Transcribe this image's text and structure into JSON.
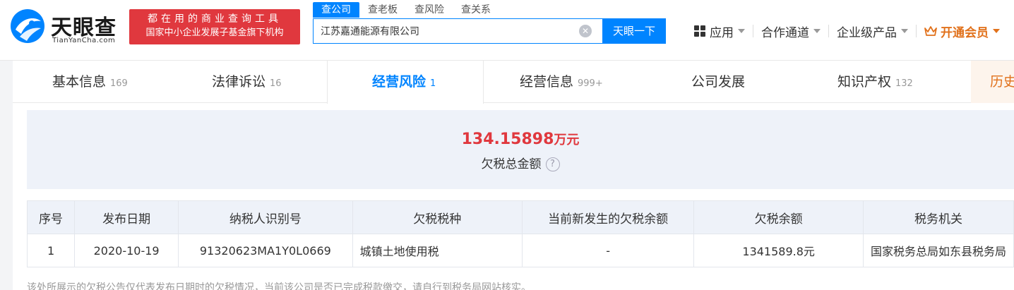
{
  "logo": {
    "name_cn": "天眼查",
    "name_en": "TianYanCha.com"
  },
  "slogan": {
    "line1": "都在用的商业查询工具",
    "line2": "国家中小企业发展子基金旗下机构"
  },
  "search": {
    "tabs": [
      "查公司",
      "查老板",
      "查风险",
      "查关系"
    ],
    "value": "江苏嘉通能源有限公司",
    "button": "天眼一下"
  },
  "nav": {
    "apps": "应用",
    "channel": "合作通道",
    "enterprise": "企业级产品",
    "vip": "开通会员"
  },
  "tabs": [
    {
      "label": "基本信息",
      "count": "169"
    },
    {
      "label": "法律诉讼",
      "count": "16"
    },
    {
      "label": "经营风险",
      "count": "1"
    },
    {
      "label": "经营信息",
      "count": "999+"
    },
    {
      "label": "公司发展",
      "count": ""
    },
    {
      "label": "知识产权",
      "count": "132"
    },
    {
      "label": "历史",
      "count": ""
    }
  ],
  "summary": {
    "amount": "134.15898",
    "unit": "万元",
    "label": "欠税总金额"
  },
  "table": {
    "headers": [
      "序号",
      "发布日期",
      "纳税人识别号",
      "欠税税种",
      "当前新发生的欠税余额",
      "欠税余额",
      "税务机关"
    ],
    "rows": [
      [
        "1",
        "2020-10-19",
        "91320623MA1Y0L0669",
        "城镇土地使用税",
        "-",
        "1341589.8元",
        "国家税务总局如东县税务局"
      ]
    ]
  },
  "note": "该处所展示的欠税公告仅代表发布日期时的欠税情况，当前该公司是否已完成税款缴交，请自行到税务局网站核实。",
  "colors": {
    "primary": "#0084ff",
    "red": "#e0383e",
    "vip": "#e1711b"
  }
}
